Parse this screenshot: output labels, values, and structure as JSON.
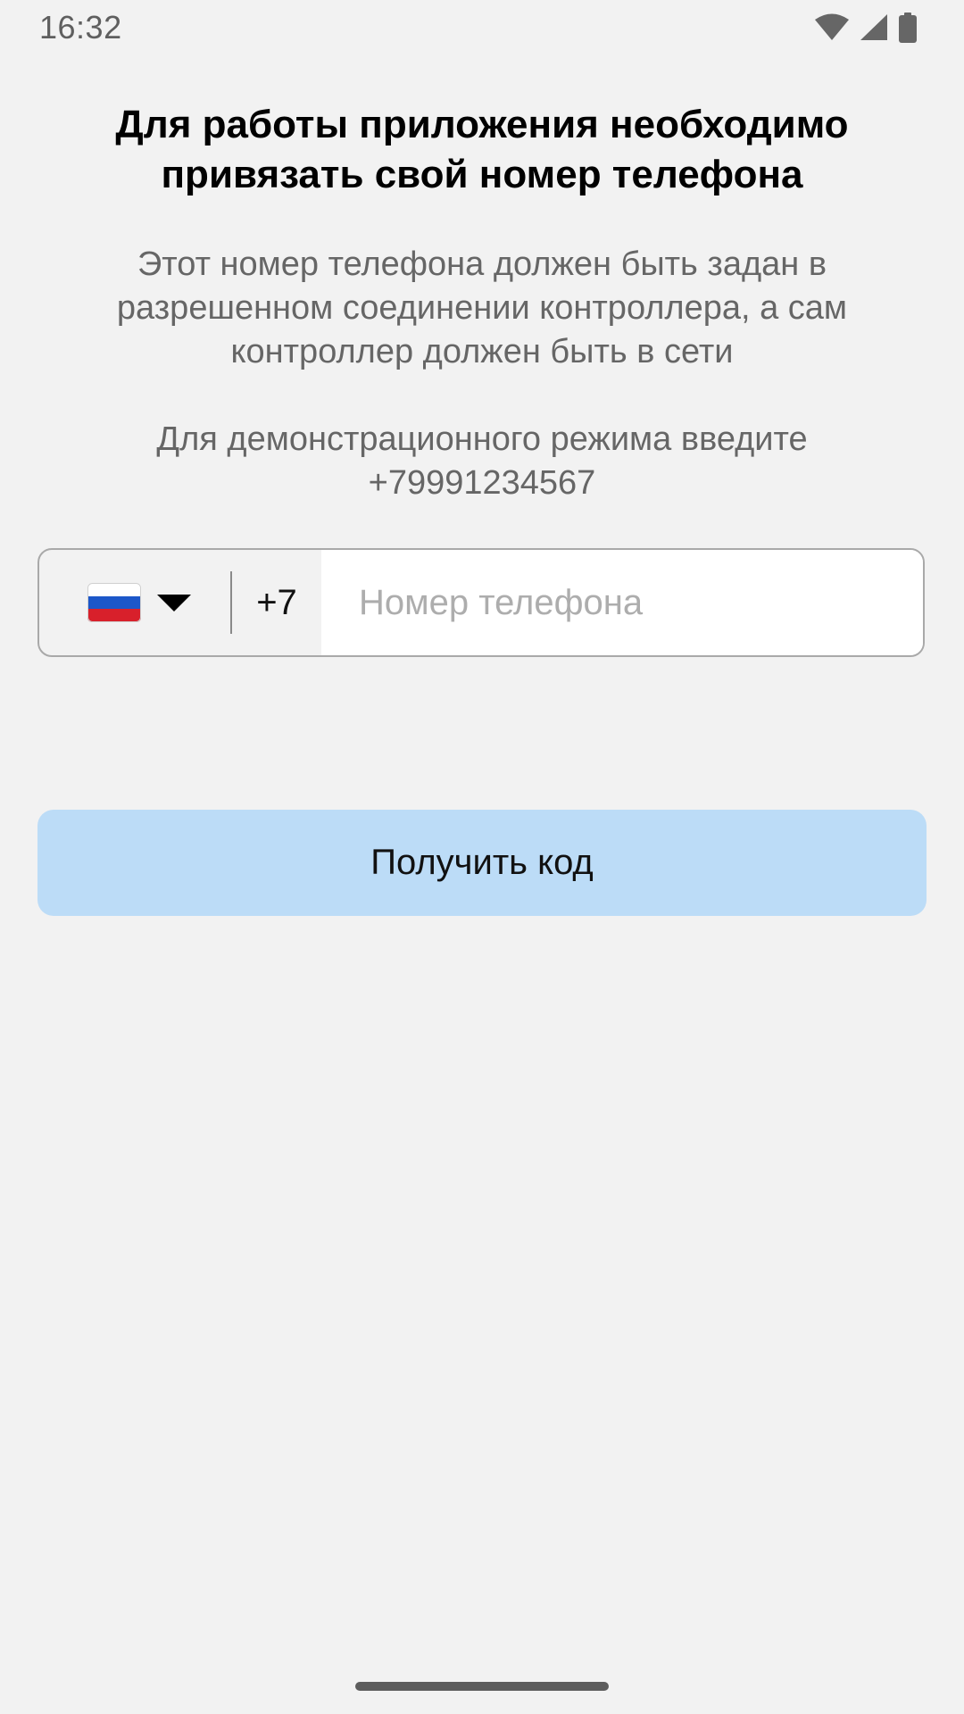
{
  "status_bar": {
    "time": "16:32",
    "icons": [
      "wifi-icon",
      "signal-icon",
      "battery-icon"
    ]
  },
  "screen": {
    "title": "Для работы приложения необходимо привязать свой номер телефона",
    "description": "Этот номер телефона должен быть задан в разрешенном соединении контроллера, а сам контроллер должен быть в сети",
    "demo_hint": "Для демонстрационного режима введите +79991234567"
  },
  "phone_input": {
    "country_flag": "russia-flag-icon",
    "dial_code": "+7",
    "value": "",
    "placeholder": "Номер телефона"
  },
  "actions": {
    "get_code_label": "Получить код"
  },
  "colors": {
    "background": "#f2f2f2",
    "button_background": "#bcdcf7",
    "muted_text": "#666666",
    "field_border": "#a9a9a9"
  }
}
